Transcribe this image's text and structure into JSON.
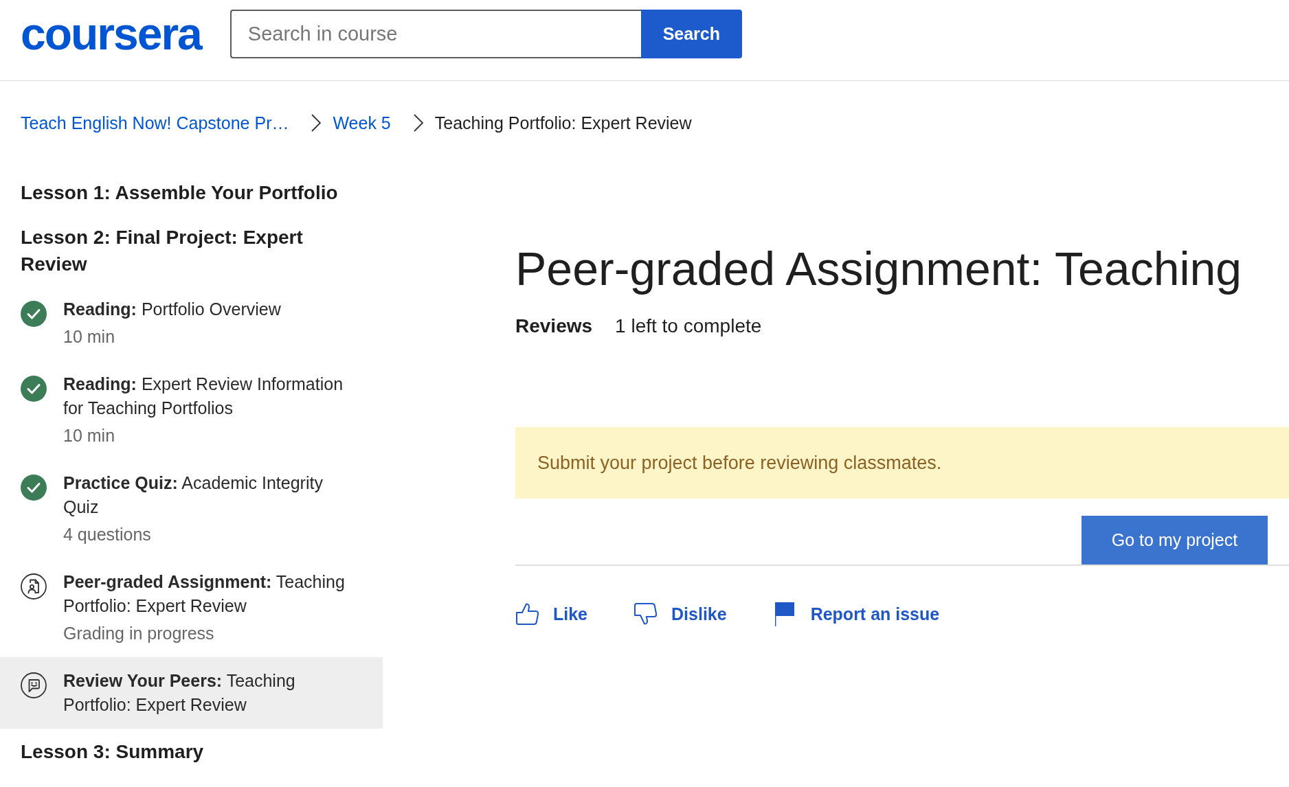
{
  "header": {
    "logo": "coursera",
    "search": {
      "placeholder": "Search in course",
      "button": "Search"
    }
  },
  "breadcrumb": [
    {
      "label": "Teach English Now! Capstone Pr…",
      "link": true
    },
    {
      "label": "Week 5",
      "link": true
    },
    {
      "label": "Teaching Portfolio: Expert Review",
      "link": false
    }
  ],
  "sidebar": {
    "lessons": [
      {
        "title": "Lesson 1: Assemble Your Portfolio"
      },
      {
        "title": "Lesson 2: Final Project: Expert Review",
        "items": [
          {
            "title": "**Reading:** Portfolio Overview",
            "meta": "10 min",
            "completed": true,
            "selected": false
          },
          {
            "title": "**Reading:** Expert Review Information for Teaching Portfolios",
            "meta": "10 min",
            "completed": true,
            "selected": false
          },
          {
            "title": "**Practice Quiz:** Academic Integrity Quiz",
            "meta": "4 questions",
            "completed": true,
            "selected": false
          },
          {
            "kind": "assignment",
            "title": "**Peer-graded Assignment:** Teaching Portfolio: Expert Review",
            "meta": "Grading in progress",
            "completed": false,
            "selected": false
          },
          {
            "kind": "review",
            "title": "**Review Your Peers:** Teaching Portfolio: Expert Review",
            "completed": false,
            "selected": true
          }
        ]
      },
      {
        "title": "Lesson 3: Summary"
      }
    ]
  },
  "main": {
    "title": "Peer-graded Assignment: Teaching",
    "reviews": {
      "label": "Reviews",
      "status": "1 left to complete"
    },
    "notice": "Submit your project before reviewing classmates.",
    "project_button": "Go to my project",
    "actions": [
      {
        "kind": "like",
        "label": "Like"
      },
      {
        "kind": "dislike",
        "label": "Dislike"
      },
      {
        "kind": "report",
        "label": "Report an issue"
      }
    ]
  }
}
